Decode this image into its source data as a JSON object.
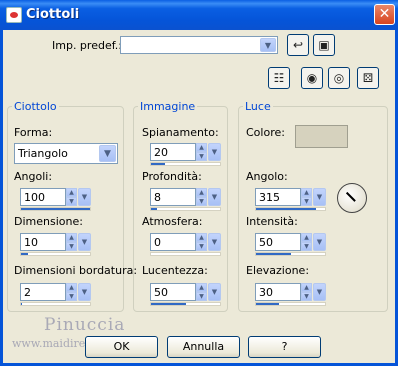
{
  "window": {
    "title": "Ciottoli",
    "close_label": "✕"
  },
  "preset": {
    "label": "Imp. predef.:",
    "value": ""
  },
  "toolbar": {
    "icons": [
      "reset-icon",
      "save-icon",
      "preview-icon",
      "eye-gear-icon",
      "eye-icon",
      "dice-icon"
    ]
  },
  "groups": {
    "ciottolo": {
      "title": "Ciottolo",
      "forma_label": "Forma:",
      "forma_value": "Triangolo",
      "angoli": {
        "label": "Angoli:",
        "value": "100",
        "fraction": 1.0
      },
      "dimensione": {
        "label": "Dimensione:",
        "value": "10",
        "fraction": 0.1
      },
      "bordatura": {
        "label": "Dimensioni bordatura:",
        "value": "2",
        "fraction": 0.02
      }
    },
    "immagine": {
      "title": "Immagine",
      "spianamento": {
        "label": "Spianamento:",
        "value": "20",
        "fraction": 0.2
      },
      "profondita": {
        "label": "Profondità:",
        "value": "8",
        "fraction": 0.08
      },
      "atmosfera": {
        "label": "Atmosfera:",
        "value": "0",
        "fraction": 0.0
      },
      "lucentezza": {
        "label": "Lucentezza:",
        "value": "50",
        "fraction": 0.5
      }
    },
    "luce": {
      "title": "Luce",
      "colore_label": "Colore:",
      "colore_value": "#d6d2be",
      "angolo": {
        "label": "Angolo:",
        "value": "315",
        "fraction": 0.875
      },
      "intensita": {
        "label": "Intensità:",
        "value": "50",
        "fraction": 0.5
      },
      "elevazione": {
        "label": "Elevazione:",
        "value": "30",
        "fraction": 0.33
      }
    }
  },
  "buttons": {
    "ok": "OK",
    "cancel": "Annulla",
    "help": "?"
  },
  "watermark": {
    "name": "Pinuccia",
    "url": "www.maidiregrafica.it"
  }
}
